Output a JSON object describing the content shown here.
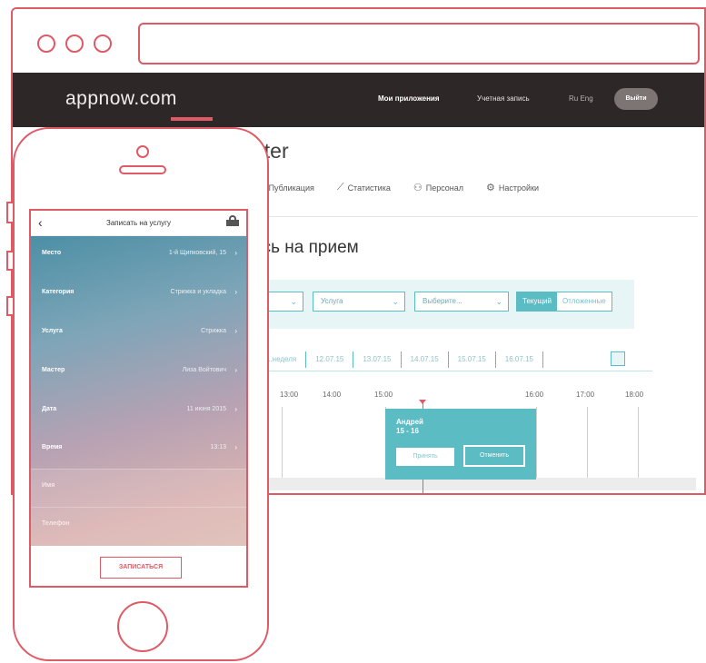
{
  "browser": {
    "site_logo": "appnow.com",
    "nav": {
      "my_apps": "Мои приложения",
      "account": "Учетная запись",
      "lang": "Ru  Eng",
      "logout": "Выйти"
    }
  },
  "dashboard": {
    "title_fragment": "nter",
    "tabs": [
      {
        "icon": "bar-chart-icon",
        "label": "Публикация"
      },
      {
        "icon": "trend-line-icon",
        "label": "Статистика"
      },
      {
        "icon": "users-icon",
        "label": "Персонал"
      },
      {
        "icon": "gear-icon",
        "label": "Настройки"
      }
    ],
    "section_title": "ись на прием",
    "filters": {
      "select1": "...",
      "select2": "Услуга",
      "select3": "Выберите...",
      "seg_on": "Текущий",
      "seg_off": "Отложенные"
    },
    "dates": [
      "...неделя",
      "12.07.15",
      "13.07.15",
      "14.07.15",
      "15.07.15",
      "16.07.15"
    ],
    "times": [
      "13:00",
      "14:00",
      "15:00",
      "16:00",
      "17:00",
      "18:00"
    ],
    "booking": {
      "name": "Андрей",
      "slot": "15 - 16",
      "btn_primary": "Принять",
      "btn_secondary": "Отменить"
    }
  },
  "phone": {
    "header": {
      "title": "Записать на услугу"
    },
    "rows": [
      {
        "label": "Место",
        "value": "1-й Щипковский, 15"
      },
      {
        "label": "Категория",
        "value": "Стрижка и укладка"
      },
      {
        "label": "Услуга",
        "value": "Стрижка"
      },
      {
        "label": "Мастер",
        "value": "Лиза Войтович"
      },
      {
        "label": "Дата",
        "value": "11 июня 2015"
      },
      {
        "label": "Время",
        "value": "13:13"
      },
      {
        "label": "Имя",
        "value": ""
      },
      {
        "label": "Телефон",
        "value": ""
      }
    ],
    "submit": "ЗАПИСАТЬСЯ"
  },
  "colors": {
    "frame": "#e05a66",
    "navbar": "#2e2727",
    "teal": "#5bbcc4"
  }
}
